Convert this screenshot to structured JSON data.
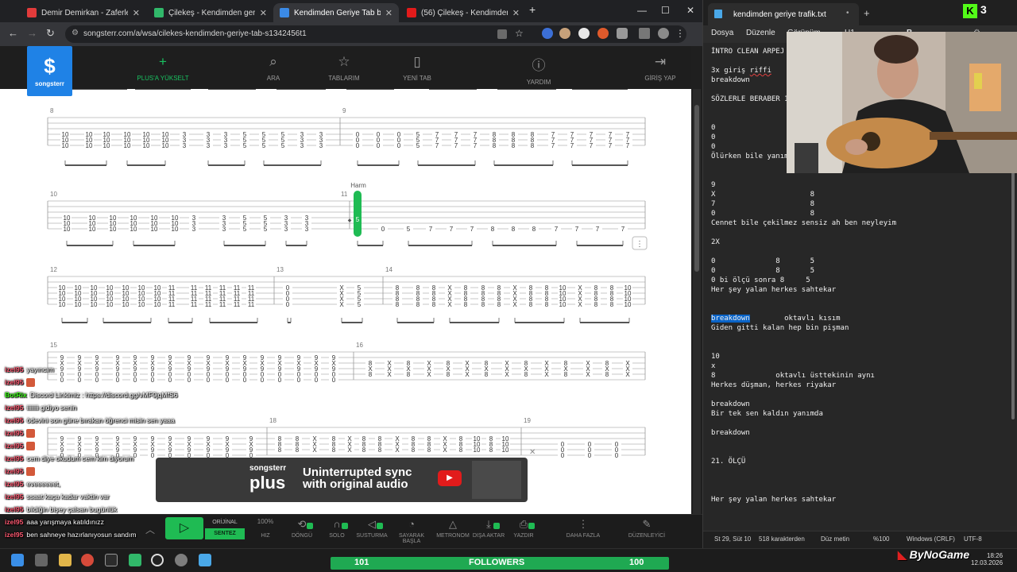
{
  "browser": {
    "tabs": [
      {
        "title": "Demir Demirkan - Zaferlerim - ...",
        "color": "#e23b3b"
      },
      {
        "title": "Çilekeş - Kendimden geriye - Al...",
        "color": "#31b86a"
      },
      {
        "title": "Kendimden Geriye Tab by Çilek...",
        "color": "#3b8ae6"
      },
      {
        "title": "(56) Çilekeş - Kendimden Geriy...",
        "color": "#e21b1b"
      }
    ],
    "new_tab": "+",
    "url": "songsterr.com/a/wsa/cilekes-kendimden-geriye-tab-s1342456t1",
    "window_controls": [
      "—",
      "☐",
      "✕"
    ]
  },
  "songsterr": {
    "logo": "songsterr",
    "nav": [
      {
        "label": "PLUS'A YÜKSELT",
        "icon": "plus-icon"
      },
      {
        "label": "ARA",
        "icon": "search-icon"
      },
      {
        "label": "TABLARIM",
        "icon": "star-icon"
      },
      {
        "label": "YENİ TAB",
        "icon": "document-icon"
      },
      {
        "label": "YARDIM",
        "icon": "help-icon"
      },
      {
        "label": "GİRİŞ YAP",
        "icon": "login-icon"
      }
    ],
    "measures": {
      "m8": "8",
      "m9": "9",
      "m10": "10",
      "m11": "11",
      "m12": "12",
      "m13": "13",
      "m14": "14",
      "m15": "15",
      "m16": "16",
      "m18": "18",
      "m19": "19"
    },
    "harm_label": "Harm",
    "cursor_fret": "5",
    "banner": {
      "brand_top": "songsterr",
      "brand_main": "plus",
      "line1": "Uninterrupted sync",
      "line2": "with original audio"
    },
    "controls": {
      "original": "ORİJİNAL",
      "synth": "SENTEZ",
      "items": [
        {
          "label": "HIZ",
          "value": "100%"
        },
        {
          "label": "DÖNGÜ"
        },
        {
          "label": "SOLO"
        },
        {
          "label": "SUSTURMA"
        },
        {
          "label": "SAYARAK BAŞLA"
        },
        {
          "label": "METRONOM"
        },
        {
          "label": "DIŞA AKTAR"
        },
        {
          "label": "YAZDIR"
        },
        {
          "label": "DAHA FAZLA"
        },
        {
          "label": "DÜZENLEYİCİ"
        }
      ]
    }
  },
  "chat": [
    {
      "user": "izel95",
      "text": "yayıncım"
    },
    {
      "user": "izel95",
      "text": "",
      "emote": true
    },
    {
      "user": "BotRix",
      "text": "Discord Linkimiz : https://discord.gg/vMF9jqMfS6",
      "bot": true
    },
    {
      "user": "izel95",
      "text": "iiiiiiii gidiyo senin"
    },
    {
      "user": "izel95",
      "text": "ödevini son güne bırakan öğrenci misin sen yaaa"
    },
    {
      "user": "izel95",
      "text": "",
      "emote": true
    },
    {
      "user": "izel95",
      "text": "",
      "emote": true
    },
    {
      "user": "izel95",
      "text": "cem diye okudum cem kim diyorum"
    },
    {
      "user": "izel95",
      "text": "",
      "emote": true
    },
    {
      "user": "izel95",
      "text": "eveeeeeet,"
    },
    {
      "user": "izel95",
      "text": "ssaat kaça kadar vaktin var"
    },
    {
      "user": "izel95",
      "text": "bildiğin bişey çalsan bugünlük"
    },
    {
      "user": "izel95",
      "text": "aaa yarışmaya katıldınızz"
    },
    {
      "user": "izel95",
      "text": "ben sahneye hazırlanıyosun sandım"
    }
  ],
  "notepad": {
    "tab_title": "kendimden geriye trafik.txt",
    "menu": [
      "Dosya",
      "Düzenle",
      "Görünüm",
      "H1"
    ],
    "lines": [
      "İNTRO CLEAN ARPEJ",
      "",
      "3x giriş riffi",
      "breakdown",
      "",
      "SÖZLERLE BERABER 1",
      "",
      "",
      "0",
      "0",
      "0",
      "Ölürken bile yanım",
      "",
      "",
      "9",
      "X                      8",
      "7                      8",
      "0                      8",
      "Cennet bile çekilmez sensiz ah ben neyleyim",
      "",
      "2X",
      "",
      "0              8       5",
      "0              8       5",
      "0 bi ölçü sonra 8     5",
      "Her şey yalan herkes sahtekar",
      "",
      "",
      "breakdown        oktavlı kısım",
      "Giden gitti kalan hep bin pişman",
      "",
      "",
      "10",
      "x",
      "8              oktavlı üsttekinin aynı",
      "Herkes düşman, herkes riyakar",
      "",
      "breakdown",
      "Bir tek sen kaldın yanımda",
      "",
      "breakdown",
      "",
      "",
      "21. ÖLÇÜ",
      "",
      "",
      "",
      "Her şey yalan herkes sahtekar"
    ],
    "status": {
      "position": "St 29, Süt 10",
      "chars": "518 karakterden",
      "mode": "Düz metin",
      "zoom": "%100",
      "eol": "Windows (CRLF)",
      "encoding": "UTF-8"
    }
  },
  "stream": {
    "kick_logo": "K",
    "viewer_count": "3",
    "followers_left": "101",
    "followers_label": "FOLLOWERS",
    "followers_right": "100",
    "watermark": "ByNoGame"
  },
  "taskbar": {
    "time": "18:26",
    "date": "12.03.2026"
  }
}
